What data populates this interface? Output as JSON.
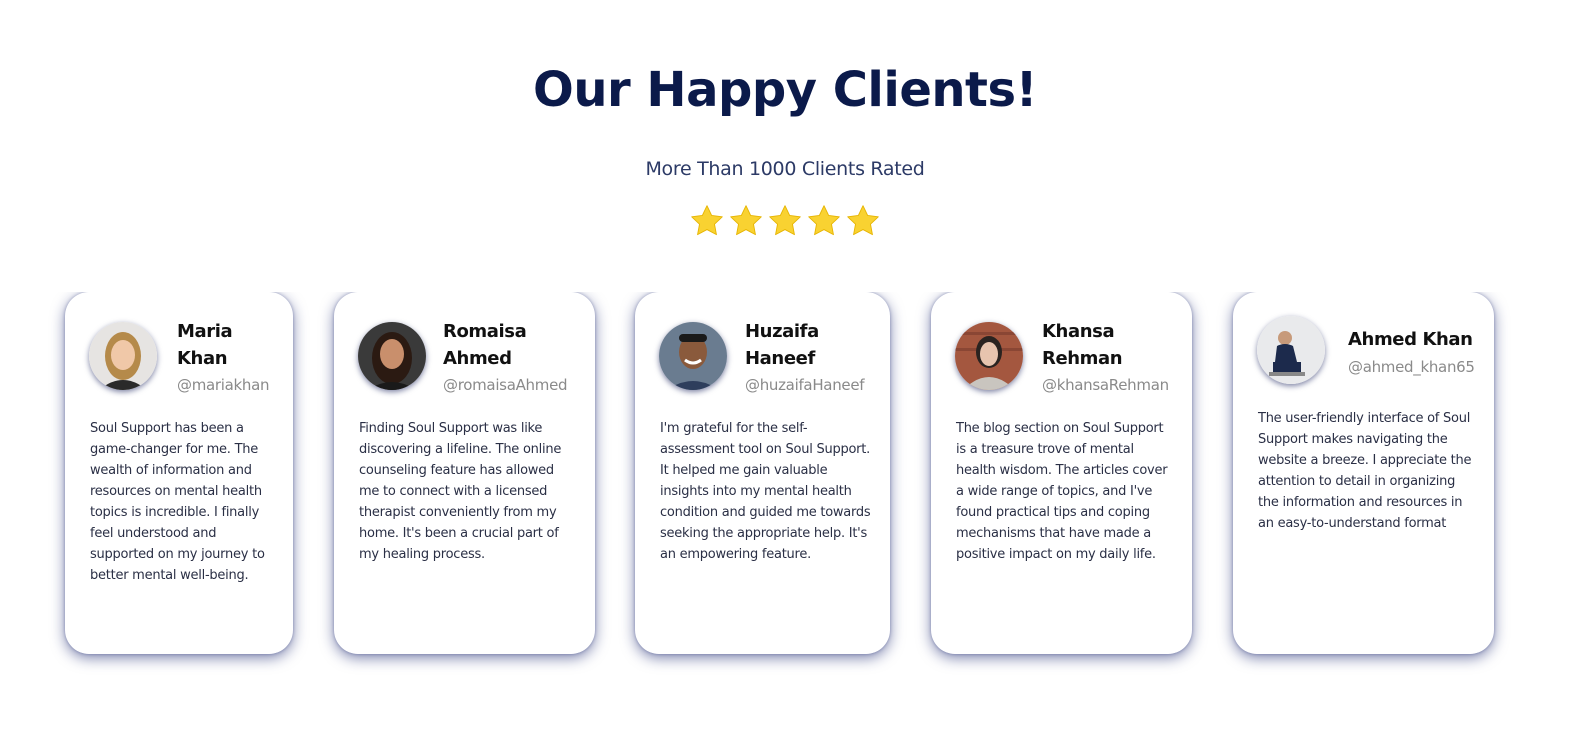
{
  "header": {
    "title": "Our Happy Clients!",
    "subtitle": "More Than 1000 Clients Rated",
    "rating_stars": 5,
    "star_color": "#f9d231"
  },
  "testimonials": [
    {
      "name": "Maria Khan",
      "handle": "@mariakhan",
      "text": "Soul Support has been a game-changer for me. The wealth of information and resources on mental health topics is incredible. I finally feel understood and supported on my journey to better mental well-being."
    },
    {
      "name": "Romaisa Ahmed",
      "handle": "@romaisaAhmed",
      "text": "Finding Soul Support was like discovering a lifeline. The online counseling feature has allowed me to connect with a licensed therapist conveniently from my home. It's been a crucial part of my healing process."
    },
    {
      "name": "Huzaifa Haneef",
      "handle": "@huzaifaHaneef",
      "text": "I'm grateful for the self-assessment tool on Soul Support. It helped me gain valuable insights into my mental health condition and guided me towards seeking the appropriate help. It's an empowering feature."
    },
    {
      "name": "Khansa Rehman",
      "handle": "@khansaRehman",
      "text": "The blog section on Soul Support is a treasure trove of mental health wisdom. The articles cover a wide range of topics, and I've found practical tips and coping mechanisms that have made a positive impact on my daily life."
    },
    {
      "name": "Ahmed Khan",
      "handle": "@ahmed_khan65",
      "text": "The user-friendly interface of Soul Support makes navigating the website a breeze. I appreciate the attention to detail in organizing the information and resources in an easy-to-understand format"
    }
  ]
}
